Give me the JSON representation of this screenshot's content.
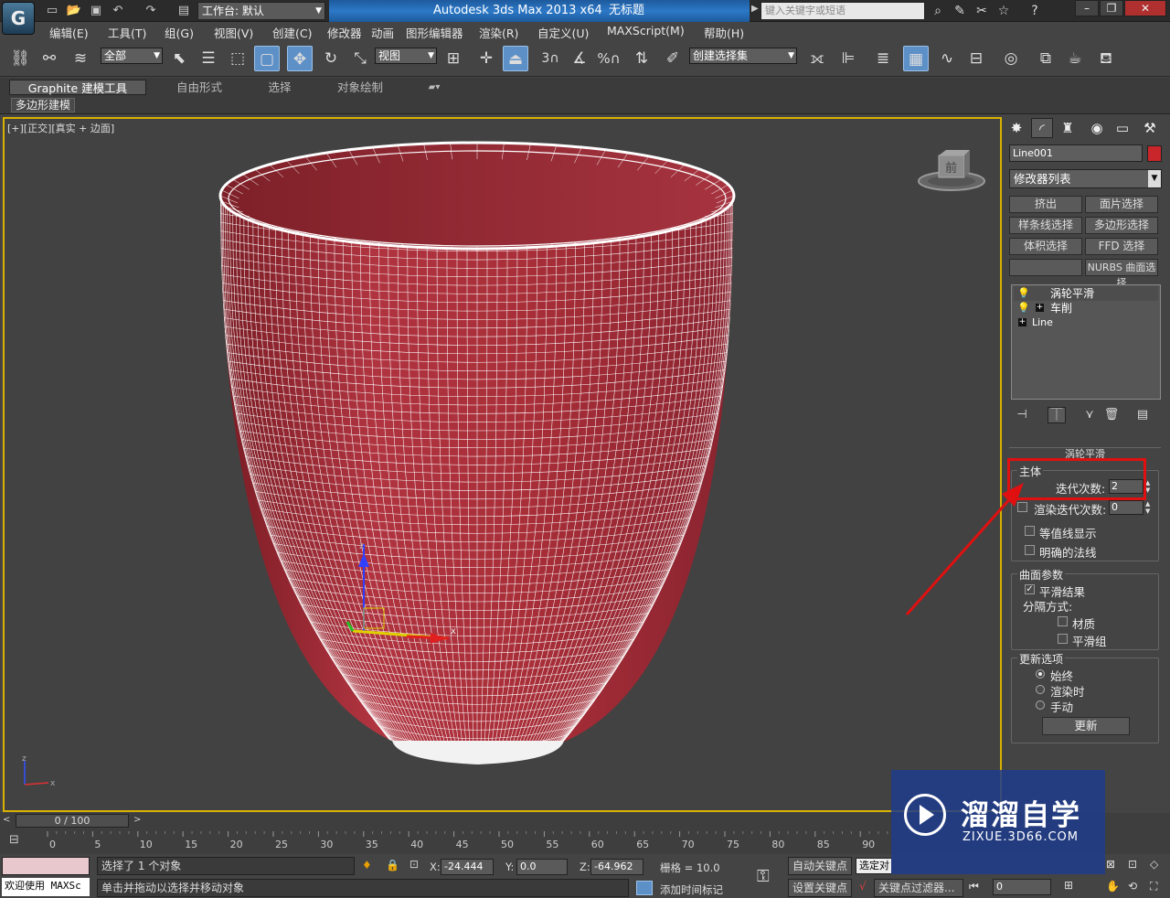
{
  "title_bar": {
    "workspace": "工作台: 默认",
    "app_title": "Autodesk 3ds Max  2013 x64",
    "doc_title": "无标题",
    "search_placeholder": "键入关键字或短语"
  },
  "menu": [
    "编辑(E)",
    "工具(T)",
    "组(G)",
    "视图(V)",
    "创建(C)",
    "修改器",
    "动画",
    "图形编辑器",
    "渲染(R)",
    "自定义(U)",
    "MAXScript(M)",
    "帮助(H)"
  ],
  "toolbar": {
    "selection_filter": "全部",
    "ref_coord": "视图",
    "snap_3": "3",
    "named_selection": "创建选择集"
  },
  "ribbon": {
    "tabs": [
      "Graphite 建模工具",
      "自由形式",
      "选择",
      "对象绘制"
    ],
    "sub_tab": "多边形建模"
  },
  "viewport": {
    "label": "[+][正交][真实 + 边面]",
    "viewcube_face": "前",
    "axis_x": "x",
    "axis_z": "z",
    "mesh_color": "#a8323a",
    "wire_color": "#ffffff"
  },
  "command_panel": {
    "object_name": "Line001",
    "object_color": "#c8262a",
    "modifier_list": "修改器列表",
    "buttons": [
      "挤出",
      "面片选择",
      "样条线选择",
      "多边形选择",
      "体积选择",
      "FFD 选择",
      "",
      "NURBS 曲面选择"
    ],
    "stack": [
      "涡轮平滑",
      "车削",
      "Line"
    ],
    "rollout_title": "涡轮平滑",
    "main_group": "主体",
    "iterations_label": "迭代次数:",
    "iterations_value": "2",
    "render_iters_label": "渲染迭代次数:",
    "render_iters_value": "0",
    "isoline": "等值线显示",
    "explicit_normals": "明确的法线",
    "surface_group": "曲面参数",
    "smooth_result": "平滑结果",
    "separate_by": "分隔方式:",
    "materials": "材质",
    "smoothing_groups": "平滑组",
    "update_group": "更新选项",
    "always": "始终",
    "when_rendering": "渲染时",
    "manually": "手动",
    "update_button": "更新"
  },
  "timeline": {
    "frame": "0 / 100",
    "ticks": [
      "0",
      "5",
      "10",
      "15",
      "20",
      "25",
      "30",
      "35",
      "40",
      "45",
      "50",
      "55",
      "60",
      "65",
      "70",
      "75",
      "80",
      "85",
      "90"
    ]
  },
  "status": {
    "selected": "选择了 1 个对象",
    "prompt": "单击并拖动以选择并移动对象",
    "welcome": "欢迎使用 MAXSc",
    "x_label": "X:",
    "x_value": "-24.444",
    "y_label": "Y:",
    "y_value": "0.0",
    "z_label": "Z:",
    "z_value": "-64.962",
    "grid": "栅格 = 10.0",
    "auto_key": "自动关键点",
    "set_key": "设置关键点",
    "selected_obj": "选定对",
    "key_filters": "关键点过滤器...",
    "add_time_tag": "添加时间标记",
    "frame_field": "0"
  },
  "watermark": {
    "title": "溜溜自学",
    "url": "ZIXUE.3D66.COM"
  }
}
